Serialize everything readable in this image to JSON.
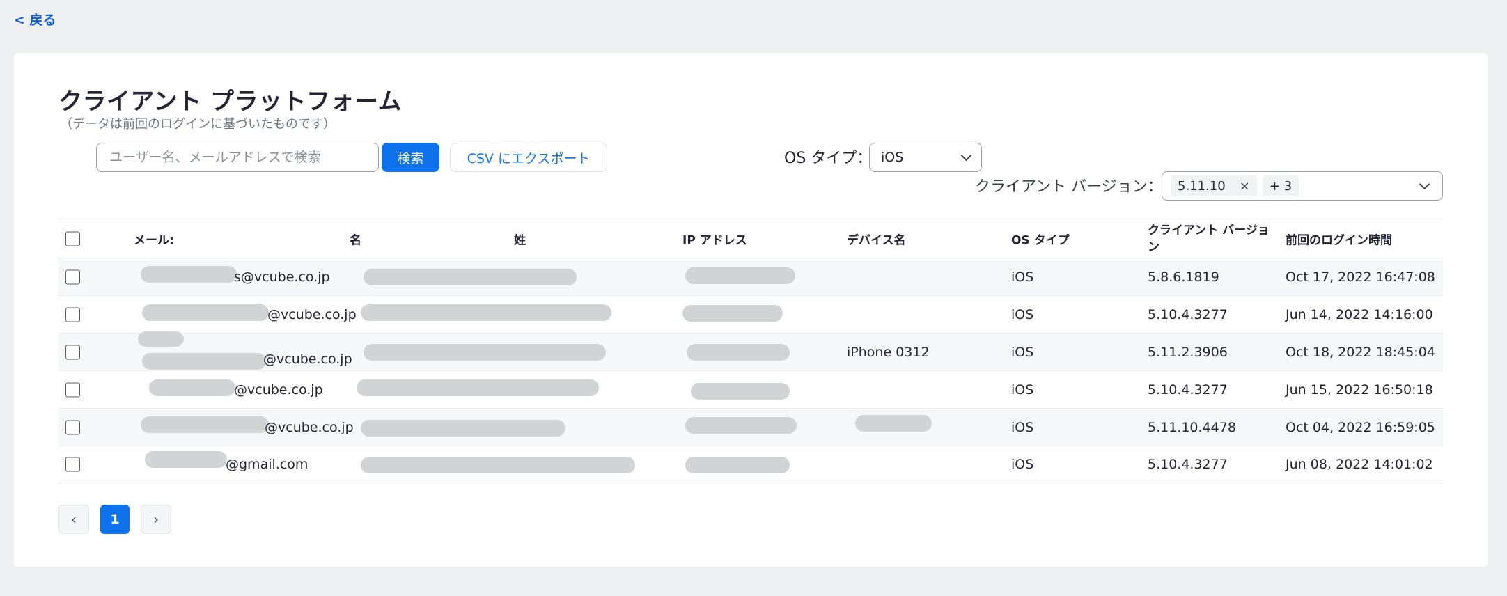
{
  "nav": {
    "back_label": "< 戻る"
  },
  "header": {
    "title": "クライアント プラットフォーム",
    "subtitle": "（データは前回のログインに基づいたものです）"
  },
  "toolbar": {
    "search_placeholder": "ユーザー名、メールアドレスで検索",
    "search_label": "検索",
    "csv_label": "CSV にエクスポート"
  },
  "filters": {
    "os_label": "OS タイプ：",
    "os_value": "iOS",
    "version_label": "クライアント バージョン：",
    "version_tag": "5.11.10",
    "version_tag_close": "×",
    "version_more": "+ 3"
  },
  "table": {
    "headers": {
      "email": "メール:",
      "first_name": "名",
      "last_name": "姓",
      "ip": "IP アドレス",
      "device": "デバイス名",
      "os": "OS タイプ",
      "version": "クライアント バージョン",
      "last_login": "前回のログイン時間"
    },
    "rows": [
      {
        "email_suffix": "s@vcube.co.jp",
        "device": "",
        "os": "iOS",
        "version": "5.8.6.1819",
        "last_login": "Oct 17, 2022 16:47:08"
      },
      {
        "email_suffix": "@vcube.co.jp",
        "device": "",
        "os": "iOS",
        "version": "5.10.4.3277",
        "last_login": "Jun 14, 2022 14:16:00"
      },
      {
        "email_suffix": "@vcube.co.jp",
        "device": "iPhone 0312",
        "os": "iOS",
        "version": "5.11.2.3906",
        "last_login": "Oct 18, 2022 18:45:04"
      },
      {
        "email_suffix": "@vcube.co.jp",
        "device": "",
        "os": "iOS",
        "version": "5.10.4.3277",
        "last_login": "Jun 15, 2022 16:50:18"
      },
      {
        "email_suffix": "@vcube.co.jp",
        "device": "",
        "os": "iOS",
        "version": "5.11.10.4478",
        "last_login": "Oct 04, 2022 16:59:05"
      },
      {
        "email_suffix": "@gmail.com",
        "device": "",
        "os": "iOS",
        "version": "5.10.4.3277",
        "last_login": "Jun 08, 2022 14:01:02"
      }
    ]
  },
  "pagination": {
    "prev": "‹",
    "current": "1",
    "next": "›"
  }
}
